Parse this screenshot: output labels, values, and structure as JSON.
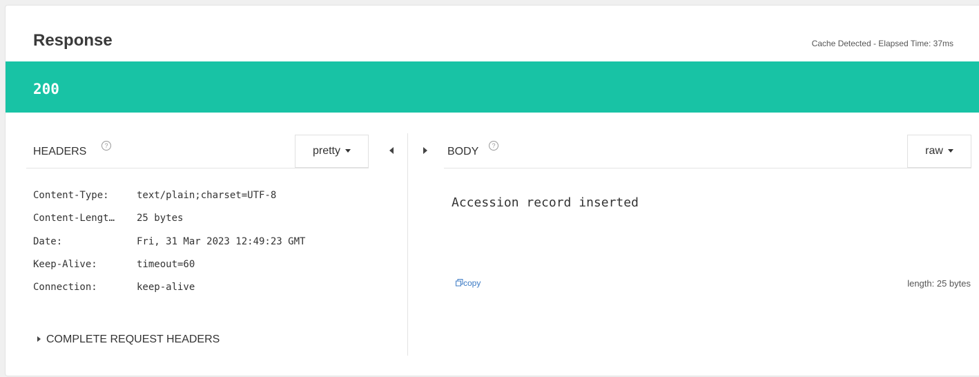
{
  "response": {
    "title": "Response",
    "elapsed": "Cache Detected - Elapsed Time: 37ms",
    "status_code": "200"
  },
  "headers_pane": {
    "title": "HEADERS",
    "help": "?",
    "format": "pretty",
    "rows": [
      {
        "name": "Content-Type:",
        "value": "text/plain;charset=UTF-8"
      },
      {
        "name": "Content-Lengt…",
        "value": "25 bytes"
      },
      {
        "name": "Date:",
        "value": "Fri, 31 Mar 2023 12:49:23 GMT"
      },
      {
        "name": "Keep-Alive:",
        "value": "timeout=60"
      },
      {
        "name": "Connection:",
        "value": "keep-alive"
      }
    ],
    "complete_request_headers": "COMPLETE REQUEST HEADERS"
  },
  "body_pane": {
    "title": "BODY",
    "help": "?",
    "format": "raw",
    "content": "Accession record inserted",
    "copy_label": "copy",
    "length": "length: 25 bytes"
  },
  "colors": {
    "status_ok": "#18c3a5",
    "link": "#3b7ac4"
  }
}
